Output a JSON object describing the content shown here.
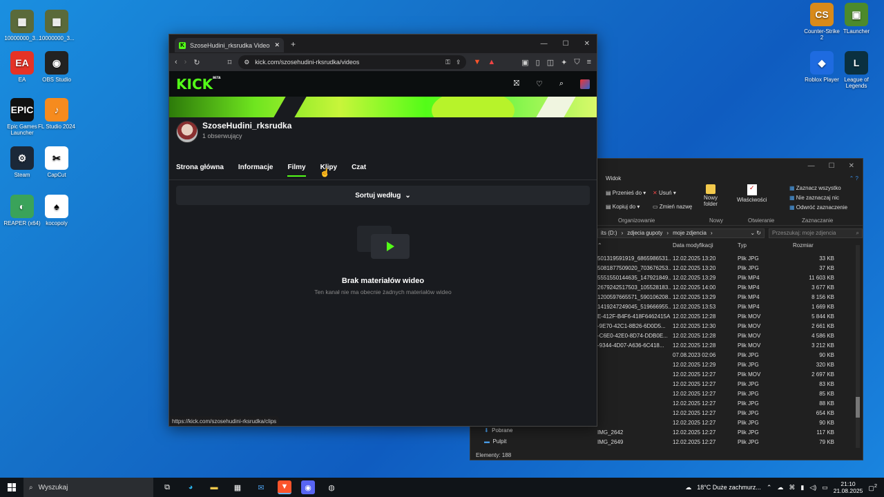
{
  "desktop": {
    "icons_left": [
      {
        "label": "10000000_3...",
        "color": "#5a6a3a",
        "glyph": "▦"
      },
      {
        "label": "10000000_3...",
        "color": "#5a6a3a",
        "glyph": "▦"
      },
      {
        "label": "EA",
        "color": "#e53326",
        "glyph": "EA"
      },
      {
        "label": "OBS Studio",
        "color": "#222",
        "glyph": "◉"
      },
      {
        "label": "Epic Games Launcher",
        "color": "#111",
        "glyph": "EPIC"
      },
      {
        "label": "FL Studio 2024",
        "color": "#f68b1e",
        "glyph": "♪"
      },
      {
        "label": "Steam",
        "color": "#1b2838",
        "glyph": "⚙"
      },
      {
        "label": "CapCut",
        "color": "#fff",
        "glyph": "✂"
      },
      {
        "label": "REAPER (x64)",
        "color": "#3aa35a",
        "glyph": "◐"
      },
      {
        "label": "kocopoly",
        "color": "#fff",
        "glyph": "♠"
      }
    ],
    "icons_right": [
      {
        "label": "Counter-Strike 2",
        "color": "#d88a1a",
        "glyph": "CS"
      },
      {
        "label": "TLauncher",
        "color": "#4c8a2c",
        "glyph": "▣"
      },
      {
        "label": "Roblox Player",
        "color": "#1e6be0",
        "glyph": "◆"
      },
      {
        "label": "League of Legends",
        "color": "#0a3040",
        "glyph": "L"
      }
    ]
  },
  "browser": {
    "tab_title": "SzoseHudini_rksrudka Videos - V",
    "new_tab": "+",
    "url": "kick.com/szosehudini-rksrudka/videos",
    "status_url": "https://kick.com/szosehudini-rksrudka/clips",
    "kick": {
      "logo": "KICK",
      "beta": "BETA",
      "channel_name": "SzoseHudini_rksrudka",
      "followers": "1 obserwujący",
      "tabs": [
        "Strona główna",
        "Informacje",
        "Filmy",
        "Klipy",
        "Czat"
      ],
      "active_tab": "Filmy",
      "sort_label": "Sortuj według",
      "empty_title": "Brak materiałów wideo",
      "empty_subtitle": "Ten kanał nie ma obecnie żadnych materiałów wideo"
    }
  },
  "explorer": {
    "tab_label": "Widok",
    "ribbon": {
      "move_to": "Przenieś do",
      "copy_to": "Kopiuj do",
      "delete": "Usuń",
      "rename": "Zmień nazwę",
      "new_folder": "Nowy folder",
      "properties": "Właściwości",
      "select_all": "Zaznacz wszystko",
      "select_none": "Nie zaznaczaj nic",
      "invert_selection": "Odwróć zaznaczenie",
      "group_organize": "Organizowanie",
      "group_new": "Nowy",
      "group_open": "Otwieranie",
      "group_select": "Zaznaczanie"
    },
    "path": [
      "its (D:)",
      "zdjecia gupoty",
      "moje zdjencia"
    ],
    "search_placeholder": "Przeszukaj: moje zdjencia",
    "columns": {
      "date": "Data modyfikacji",
      "type": "Typ",
      "size": "Rozmiar"
    },
    "files": [
      {
        "name": "501319591919_6865986531...",
        "date": "12.02.2025 13:20",
        "type": "Plik JPG",
        "size": "33 KB"
      },
      {
        "name": "5081877509020_703676253...",
        "date": "12.02.2025 13:20",
        "type": "Plik JPG",
        "size": "37 KB"
      },
      {
        "name": "5551550144635_147921849...",
        "date": "12.02.2025 13:29",
        "type": "Plik MP4",
        "size": "11 603 KB"
      },
      {
        "name": "2679242517503_105528183...",
        "date": "12.02.2025 14:00",
        "type": "Plik MP4",
        "size": "3 677 KB"
      },
      {
        "name": "1200597665571_590106208...",
        "date": "12.02.2025 13:29",
        "type": "Plik MP4",
        "size": "8 156 KB"
      },
      {
        "name": "1419247249045_519666955...",
        "date": "12.02.2025 13:53",
        "type": "Plik MP4",
        "size": "1 669 KB"
      },
      {
        "name": "E-412F-B4F6-418F6462415A",
        "date": "12.02.2025 12:28",
        "type": "Plik MOV",
        "size": "5 844 KB"
      },
      {
        "name": "-9E70-42C1-8B26-6D0D5...",
        "date": "12.02.2025 12:30",
        "type": "Plik MOV",
        "size": "2 661 KB"
      },
      {
        "name": "-C6E0-42E0-8D74-DDB0E...",
        "date": "12.02.2025 12:28",
        "type": "Plik MOV",
        "size": "4 586 KB"
      },
      {
        "name": "-9344-4D07-A636-6C418...",
        "date": "12.02.2025 12:28",
        "type": "Plik MOV",
        "size": "3 212 KB"
      },
      {
        "name": "",
        "date": "07.08.2023 02:06",
        "type": "Plik JPG",
        "size": "90 KB"
      },
      {
        "name": "",
        "date": "12.02.2025 12:29",
        "type": "Plik JPG",
        "size": "320 KB"
      },
      {
        "name": "",
        "date": "12.02.2025 12:27",
        "type": "Plik MOV",
        "size": "2 697 KB"
      },
      {
        "name": "",
        "date": "12.02.2025 12:27",
        "type": "Plik JPG",
        "size": "83 KB"
      },
      {
        "name": "",
        "date": "12.02.2025 12:27",
        "type": "Plik JPG",
        "size": "85 KB"
      },
      {
        "name": "",
        "date": "12.02.2025 12:27",
        "type": "Plik JPG",
        "size": "88 KB"
      },
      {
        "name": "",
        "date": "12.02.2025 12:27",
        "type": "Plik JPG",
        "size": "654 KB"
      },
      {
        "name": "",
        "date": "12.02.2025 12:27",
        "type": "Plik JPG",
        "size": "90 KB"
      },
      {
        "name": "IMG_2642",
        "date": "12.02.2025 12:27",
        "type": "Plik JPG",
        "size": "117 KB"
      },
      {
        "name": "IMG_2649",
        "date": "12.02.2025 12:27",
        "type": "Plik JPG",
        "size": "79 KB"
      }
    ],
    "nav": {
      "downloads": "Pobrane",
      "desktop": "Pulpit"
    },
    "status": "Elementy: 188"
  },
  "taskbar": {
    "search": "Wyszukaj",
    "weather": "18°C  Duże zachmurz...",
    "time": "21:10",
    "date": "21.08.2025",
    "notifications": "2"
  },
  "colors": {
    "kick_green": "#53fc18",
    "desktop_blue": "#1570c8"
  }
}
